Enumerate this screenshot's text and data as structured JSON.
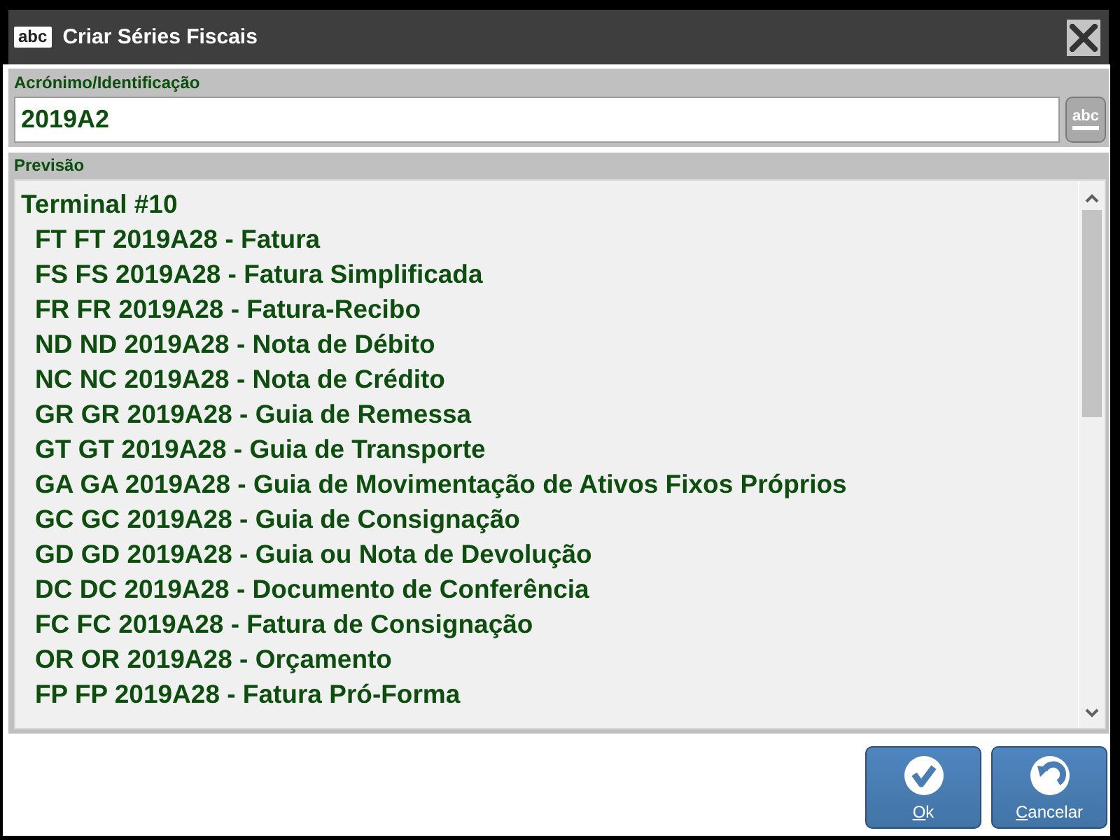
{
  "window": {
    "title": "Criar Séries Fiscais",
    "logo_text": "abc"
  },
  "identification": {
    "label": "Acrónimo/Identificação",
    "value": "2019A2",
    "keyboard_button": "abc"
  },
  "preview": {
    "label": "Previsão",
    "tree": [
      {
        "text": "Terminal #10",
        "children": [
          {
            "text": "FT FT 2019A28 - Fatura"
          },
          {
            "text": "FS FS 2019A28 - Fatura Simplificada"
          },
          {
            "text": "FR FR 2019A28 - Fatura-Recibo"
          },
          {
            "text": "ND ND 2019A28 - Nota de Débito"
          },
          {
            "text": "NC NC 2019A28 - Nota de Crédito"
          },
          {
            "text": "GR GR 2019A28 - Guia de Remessa"
          },
          {
            "text": "GT GT 2019A28 - Guia de Transporte"
          },
          {
            "text": "GA GA 2019A28 - Guia de Movimentação de Ativos Fixos Próprios"
          },
          {
            "text": "GC GC 2019A28 - Guia de Consignação"
          },
          {
            "text": "GD GD 2019A28 - Guia ou Nota de Devolução"
          },
          {
            "text": "DC DC 2019A28 - Documento de Conferência"
          },
          {
            "text": "FC FC 2019A28 - Fatura de Consignação"
          },
          {
            "text": "OR OR 2019A28 - Orçamento"
          },
          {
            "text": "FP FP 2019A28 - Fatura Pró-Forma"
          }
        ]
      }
    ]
  },
  "buttons": [
    {
      "label": "Ok",
      "kind": "confirm"
    },
    {
      "label": "Cancelar",
      "kind": "cancel"
    }
  ]
}
